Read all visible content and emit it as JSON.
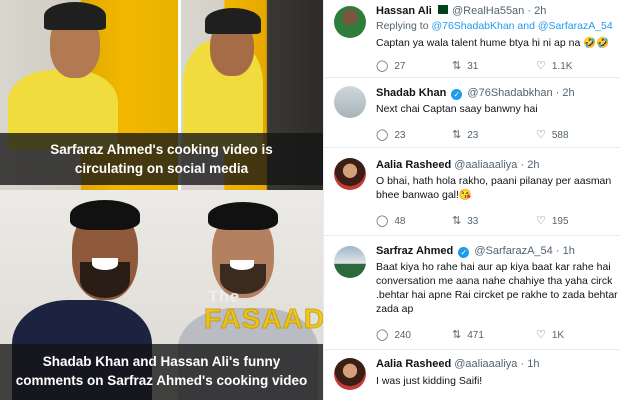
{
  "captions": {
    "top": [
      "Sarfaraz Ahmed's cooking video is",
      "circulating on social media"
    ],
    "bottom": [
      "Shadab Khan and Hassan Ali's funny",
      "comments on Sarfraz Ahmed's cooking video"
    ]
  },
  "watermark": {
    "small": "The",
    "main": "FASAADI"
  },
  "tweets": [
    {
      "name": "Hassan Ali",
      "handle": "@RealHa55an",
      "time": "· 2h",
      "reply_prefix": "Replying to ",
      "reply_mentions": "@76ShadabKhan and @SarfarazA_54",
      "lines": [
        "Captan ya wala talent hume btya hi ni ap na 🤣🤣"
      ],
      "replies": "27",
      "retweets": "31",
      "likes": "1.1K"
    },
    {
      "name": "Shadab Khan",
      "handle": "@76Shadabkhan",
      "time": "· 2h",
      "lines": [
        "Next chai Captan saay banwny hai"
      ],
      "replies": "23",
      "retweets": "23",
      "likes": "588"
    },
    {
      "name": "Aalia Rasheed",
      "handle": "@aaliaaaliya",
      "time": "· 2h",
      "lines": [
        "O bhai, hath hola rakho, paani pilanay per aasman",
        "bhee banwao gal!😘"
      ],
      "replies": "48",
      "retweets": "33",
      "likes": "195"
    },
    {
      "name": "Sarfraz Ahmed",
      "handle": "@SarfarazA_54",
      "time": "· 1h",
      "lines": [
        "Baat kiya ho rahe hai aur ap kiya baat kar rahe hai",
        "conversation me aana nahe chahiye tha yaha circk",
        ".behtar hai apne Rai circket pe rakhe to zada behtar",
        "zada ap"
      ],
      "replies": "240",
      "retweets": "471",
      "likes": "1K"
    },
    {
      "name": "Aalia Rasheed",
      "handle": "@aaliaaaliya",
      "time": "· 1h",
      "lines": [
        "I was just kidding Saifi!"
      ],
      "replies": "",
      "retweets": "",
      "likes": ""
    }
  ],
  "icons": {
    "reply": "reply-icon",
    "retweet": "retweet-icon",
    "like": "heart-icon"
  },
  "colors": {
    "verified": "#1d9bf0",
    "caption_bg": "#141414",
    "watermark": "#f3c400"
  }
}
